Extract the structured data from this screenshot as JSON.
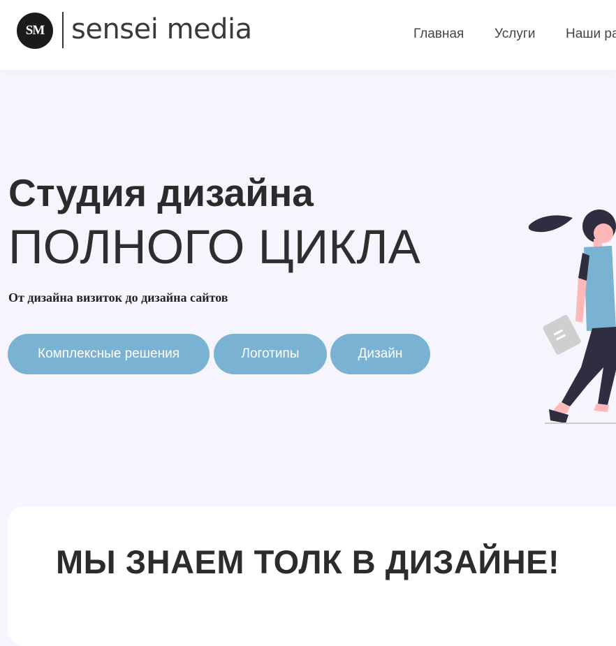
{
  "header": {
    "logo_mark": "SM",
    "logo_text": "sensei media",
    "nav": [
      "Главная",
      "Услуги",
      "Наши ра"
    ]
  },
  "hero": {
    "title": "Студия дизайна",
    "subtitle": "ПОЛНОГО ЦИКЛА",
    "tagline": "От дизайна визиток до дизайна сайтов",
    "buttons": [
      "Комплексные решения",
      "Логотипы",
      "Дизайн"
    ],
    "illustration": "woman-walking-with-document-illustration"
  },
  "section": {
    "title": "МЫ ЗНАЕМ ТОЛК В ДИЗАЙНЕ!"
  },
  "colors": {
    "background": "#f6f5fd",
    "button": "#7ab2d3",
    "text": "#333333"
  }
}
